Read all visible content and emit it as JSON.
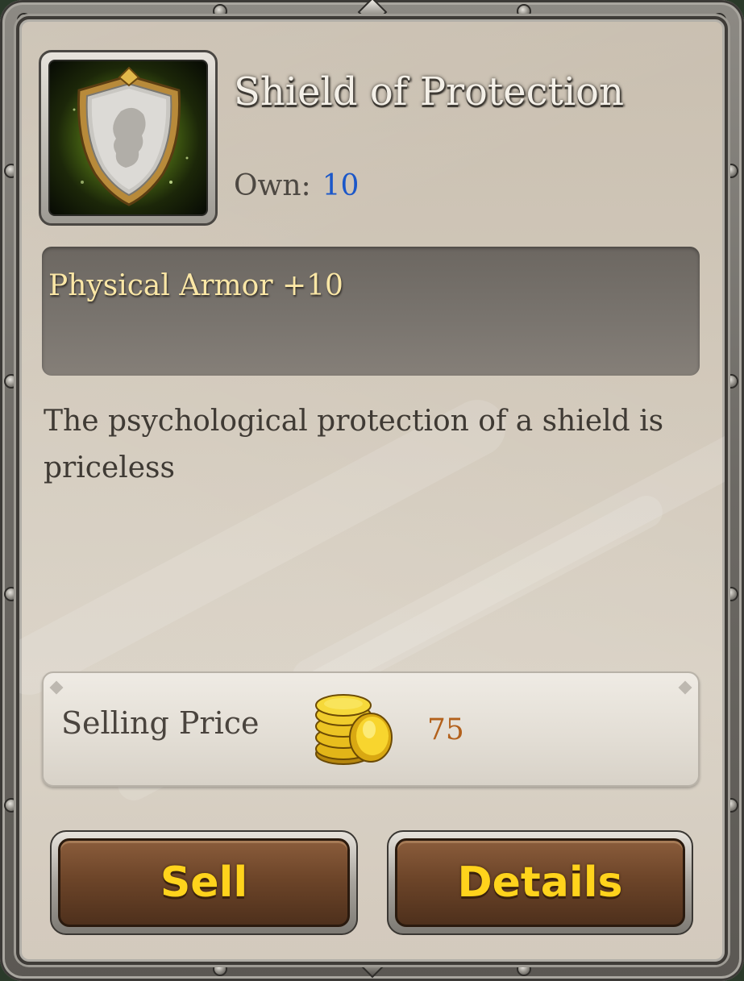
{
  "item": {
    "name": "Shield of Protection",
    "own_label": "Own:",
    "own_count": "10",
    "icon": "shield-icon"
  },
  "stats": [
    "Physical Armor +10"
  ],
  "description": "The psychological protection of a shield is priceless",
  "price": {
    "label": "Selling Price",
    "value": "75",
    "icon": "gold-coins-icon"
  },
  "buttons": {
    "sell_label": "Sell",
    "details_label": "Details"
  },
  "colors": {
    "title_text": "#f4f0e8",
    "own_value": "#1b57c9",
    "stat_text": "#fbe7a6",
    "price_value": "#b3611c",
    "button_text": "#ffd31c",
    "button_face": "#6d4529",
    "panel": "#d2c9bb"
  }
}
